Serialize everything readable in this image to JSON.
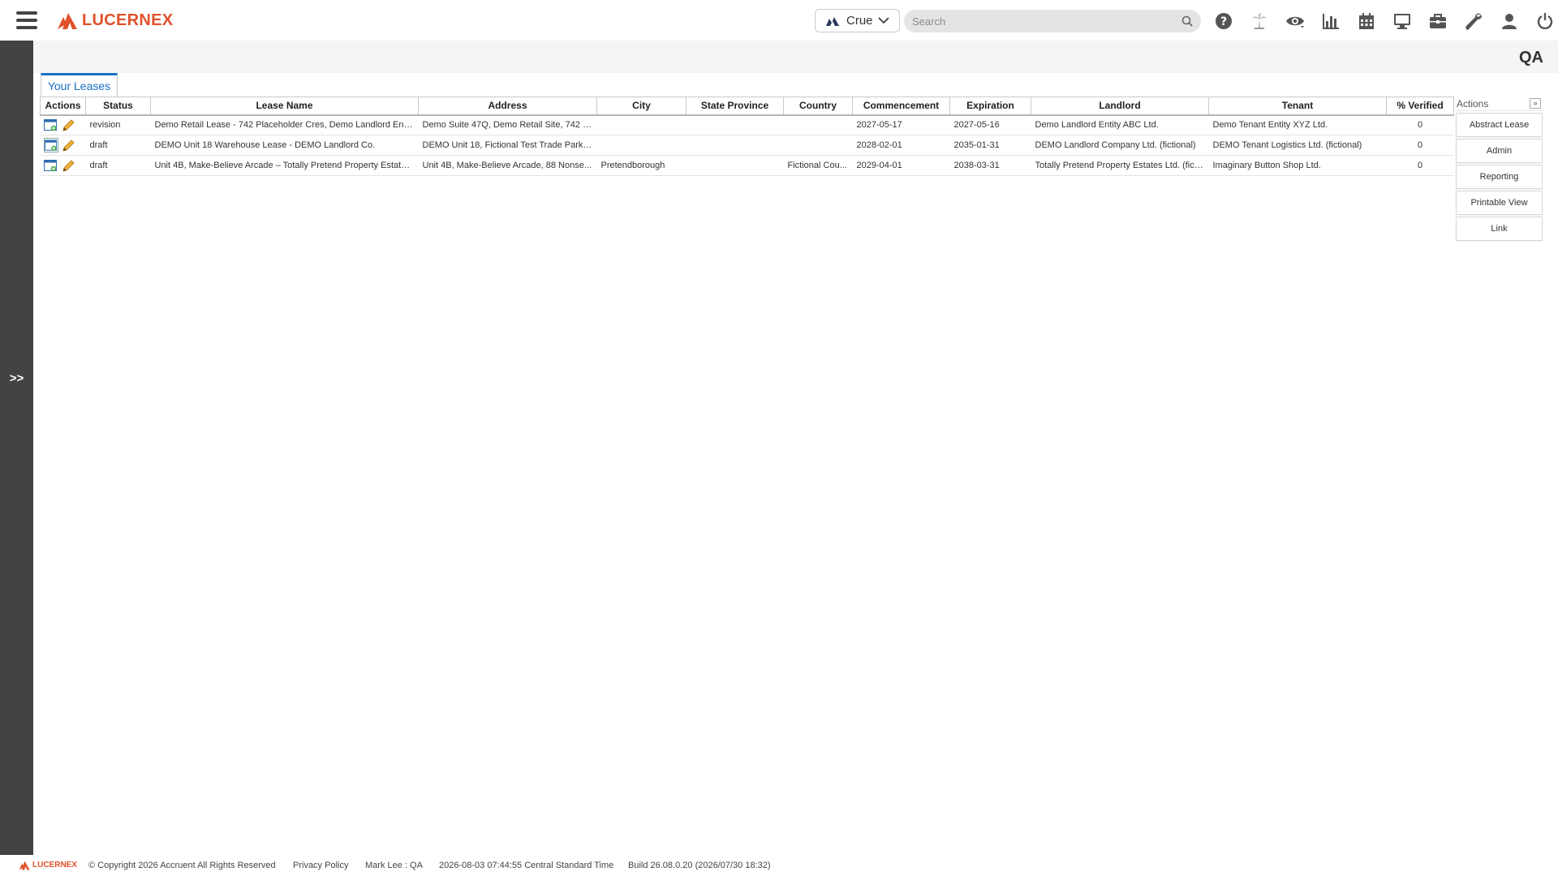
{
  "app": {
    "brand": "LUCERNEX",
    "org_selector": {
      "value": "Crue",
      "icon": "org-logo-icon"
    },
    "search": {
      "placeholder": "Search",
      "value": ""
    },
    "top_icons": [
      "help-icon",
      "palm-tree-icon",
      "eye-icon",
      "bar-chart-icon",
      "calendar-icon",
      "monitor-icon",
      "briefcase-icon",
      "wrench-icon",
      "user-icon",
      "power-icon"
    ],
    "environment_label": "QA",
    "left_rail_toggle": ">>"
  },
  "tabs": [
    {
      "label": "Your Leases",
      "active": true
    }
  ],
  "grid": {
    "columns": [
      "Actions",
      "Status",
      "Lease Name",
      "Address",
      "City",
      "State Province",
      "Country",
      "Commencement",
      "Expiration",
      "Landlord",
      "Tenant",
      "% Verified"
    ],
    "rows": [
      {
        "status": "revision",
        "lease_name": "Demo Retail Lease - 742 Placeholder Cres, Demo Landlord Entit...",
        "address": "Demo Suite 47Q, Demo Retail Site, 742 P...",
        "city": "",
        "state_province": "",
        "country": "",
        "commencement": "2027-05-17",
        "expiration": "2027-05-16",
        "landlord": "Demo Landlord Entity ABC Ltd.",
        "tenant": "Demo Tenant Entity XYZ Ltd.",
        "verified": "0"
      },
      {
        "status": "draft",
        "lease_name": "DEMO Unit 18 Warehouse Lease - DEMO Landlord Co.",
        "address": "DEMO Unit 18, Fictional Test Trade Park, ...",
        "city": "",
        "state_province": "",
        "country": "",
        "commencement": "2028-02-01",
        "expiration": "2035-01-31",
        "landlord": "DEMO Landlord Company Ltd. (fictional)",
        "tenant": "DEMO Tenant Logistics Ltd. (fictional)",
        "verified": "0"
      },
      {
        "status": "draft",
        "lease_name": "Unit 4B, Make-Believe Arcade – Totally Pretend Property Estates...",
        "address": "Unit 4B, Make-Believe Arcade, 88 Nonse...",
        "city": "Pretendborough",
        "state_province": "",
        "country": "Fictional Cou...",
        "commencement": "2029-04-01",
        "expiration": "2038-03-31",
        "landlord": "Totally Pretend Property Estates Ltd. (ficti...",
        "tenant": "Imaginary Button Shop Ltd.",
        "verified": "0"
      }
    ]
  },
  "actions_panel": {
    "title": "Actions",
    "collapse_label": "»",
    "buttons": [
      "Abstract Lease",
      "Admin",
      "Reporting",
      "Printable View",
      "Link"
    ]
  },
  "footer": {
    "brand": "LUCERNEX",
    "copyright": "© Copyright 2026 Accruent All Rights Reserved",
    "privacy": "Privacy Policy",
    "user": "Mark Lee : QA",
    "datetime": "2026-08-03 07:44:55 Central Standard Time",
    "build": "Build 26.08.0.20 (2026/07/30 18:32)"
  },
  "colors": {
    "brand_orange": "#e0522b",
    "tab_blue": "#1a6fc4",
    "left_rail": "#434343"
  }
}
